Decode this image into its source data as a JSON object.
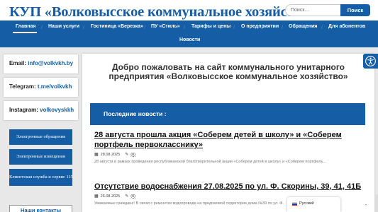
{
  "header": {
    "site_title": "КУП «Волковысское коммунальное хозяйство»",
    "search_placeholder": "Поиск…",
    "search_button": "Поиск"
  },
  "nav": {
    "items": [
      "Главная",
      "Наши услуги",
      "Гостиница «Березка»",
      "ПУ «Стиль»",
      "Тарифы и цены",
      "О предприятии",
      "Обращения",
      "Для абонентов",
      "Новости"
    ],
    "active": "Главная"
  },
  "sidebar": {
    "email_label": "Email:",
    "email_value": "info@volkvkh.by",
    "telegram_label": "Telegram:",
    "telegram_value": "t.me/volkvkh",
    "instagram_label": "Instagram:",
    "instagram_value": "volkovyskkh",
    "buttons": [
      "Электронные обращения",
      "Электронные извещения",
      "Клиентская служба и сервис 115"
    ],
    "contacts_button": "Наши контакты"
  },
  "main": {
    "welcome": "Добро пожаловать на сайт коммунального унитарного предприятия «Волковысское коммунальное хозяйство»",
    "news_header": "Последние новости :",
    "articles": [
      {
        "title": "28 августа прошла акция «Соберем детей в школу» и «Соберем портфель первокласснику»",
        "date": "28.08.2025",
        "comments": "(0)",
        "excerpt": "28 августа в рамках проведения республиканской благотворительной акции «Соберем детей в школу» и «Соберем портфель..."
      },
      {
        "title": "Отсутствие водоснабжения 27.08.2025 по ул. Ф. Скорины, 39, 41, 41Б",
        "date": "26.08.2025",
        "comments": "(0)",
        "excerpt": "Уважаемые граждане! В связи с ремонтом водопровода на придомовой территории дома №39 по ул. Ф."
      }
    ]
  },
  "language": {
    "current": "Русский"
  },
  "colors": {
    "brand": "#155ea5",
    "background": "#e8e8e8"
  },
  "icons": {
    "accessibility": "accessibility-icon",
    "calendar": "calendar-icon",
    "comments": "comments-icon",
    "scroll_up": "chevron-up-icon",
    "flag": "russia-flag-icon"
  }
}
